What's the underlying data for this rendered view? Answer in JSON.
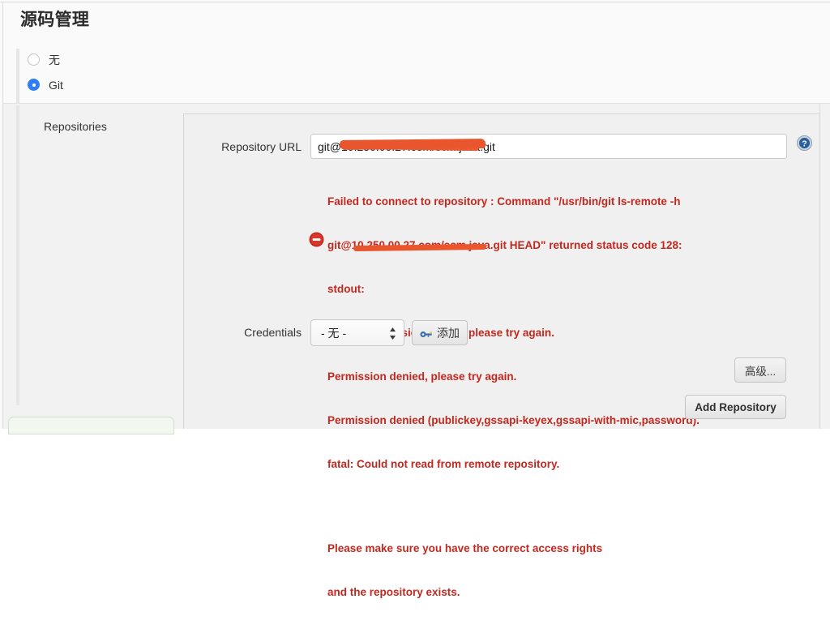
{
  "page": {
    "title": "源码管理"
  },
  "scm_options": [
    {
      "label": "无",
      "selected": false,
      "name": "none"
    },
    {
      "label": "Git",
      "selected": true,
      "name": "git"
    }
  ],
  "repositories": {
    "section_label": "Repositories",
    "repository_url": {
      "label": "Repository URL",
      "value": "git@10.250.00.27.com/scm.java.git",
      "placeholder": ""
    },
    "help_icon": "help-circle-icon",
    "error": {
      "icon": "error-denied-icon",
      "lines": [
        "Failed to connect to repository : Command \"/usr/bin/git ls-remote -h",
        "git@10.250.00.27.com/scm.java.git HEAD\" returned status code 128:",
        "stdout:",
        "stderr: Permission denied, please try again.",
        "Permission denied, please try again.",
        "Permission denied (publickey,gssapi-keyex,gssapi-with-mic,password).",
        "fatal: Could not read from remote repository.",
        "",
        "Please make sure you have the correct access rights",
        "and the repository exists."
      ],
      "color": "#c3281f"
    },
    "credentials": {
      "label": "Credentials",
      "selected_value": "- 无 -",
      "options": [
        "- 无 -"
      ],
      "add_button": {
        "label": "添加",
        "icon": "key-icon"
      }
    },
    "advanced_button": "高级...",
    "add_repository_button": "Add Repository"
  },
  "colors": {
    "accent": "#2f7ff2",
    "error_text": "#c3281f",
    "redaction": "#e9552d",
    "panel_bg": "#f0f0f0",
    "page_bg": "#fafafa"
  }
}
